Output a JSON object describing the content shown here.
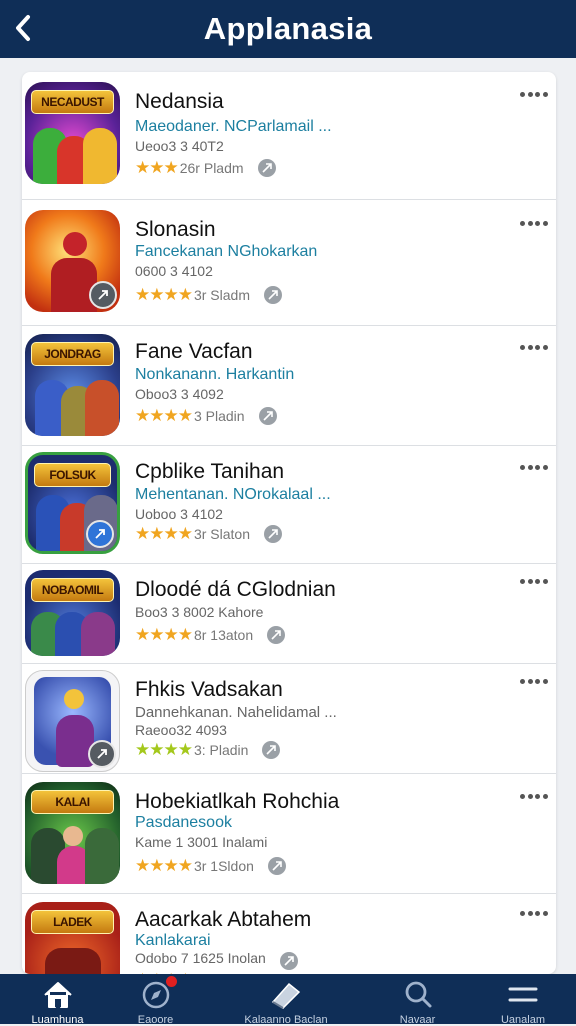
{
  "header": {
    "title": "Applanasia"
  },
  "apps": [
    {
      "name": "Nedansia",
      "developer": "Maeodaner. NCParlamail ...",
      "info": "Ueoo3 3 40T2",
      "stars": "★★★",
      "rating_text": "26r Pladm",
      "icon_banner": "NECADUST",
      "icon_bg": "#6b2fa8",
      "star_style": "orange"
    },
    {
      "name": "Slonasin",
      "developer": "Fancekanan NGhokarkan",
      "info": "0600 3 4102",
      "stars": "★★★★",
      "rating_text": "3r Sladm",
      "icon_banner": "",
      "icon_bg": "#f08a1a",
      "star_style": "orange"
    },
    {
      "name": "Fane Vacfan",
      "developer": "Nonkanann. Harkantin",
      "info": "Oboo3 3 4092",
      "stars": "★★★★",
      "rating_text": "3 Pladin",
      "icon_banner": "JONDRAG",
      "icon_bg": "#2b4fa8",
      "star_style": "orange"
    },
    {
      "name": "Cpblike Tanihan",
      "developer": "Mehentanan. NOrokalaal ...",
      "info": "Uoboo 3 4102",
      "stars": "★★★★",
      "rating_text": "3r Slaton",
      "icon_banner": "FOLSUK",
      "icon_bg": "#243a8a",
      "star_style": "orange"
    },
    {
      "name": "Dloodé dá CGlodnian",
      "developer": "",
      "info": "Boo3 3 8002 Kahore",
      "stars": "★★★★",
      "rating_text": "8r 13aton",
      "icon_banner": "NOBAOMIL",
      "icon_bg": "#1f3d8e",
      "star_style": "orange"
    },
    {
      "name": "Fhkis Vadsakan",
      "developer": "Dannehkanan. Nahelidamal ...",
      "info": "Raeoo32 4093",
      "stars": "★★★★",
      "rating_text": "3: Pladin",
      "icon_banner": "",
      "icon_bg": "#3a68c0",
      "star_style": "green"
    },
    {
      "name": "Hobekiatlkah Rohchia",
      "developer": "Pasdanesook",
      "info": "Kame 1 3001 Inalami",
      "stars": "★★★★",
      "rating_text": "3r 1Sldon",
      "icon_banner": "KALAI",
      "icon_bg": "#2c7a35",
      "star_style": "orange"
    },
    {
      "name": "Aacarkak Abtahem",
      "developer": "Kanlakarai",
      "info": "Odobo 7 1625 Inolan",
      "stars": "★★★★",
      "rating_text": "",
      "icon_banner": "LADEK",
      "icon_bg": "#c23a1e",
      "star_style": "orange"
    }
  ],
  "tabbar": {
    "tabs": [
      {
        "label": "Luamhuna"
      },
      {
        "label": "Eaoore"
      },
      {
        "label": "Kalaanno Baclan"
      },
      {
        "label": "Navaar"
      },
      {
        "label": "Uanalam"
      }
    ]
  }
}
